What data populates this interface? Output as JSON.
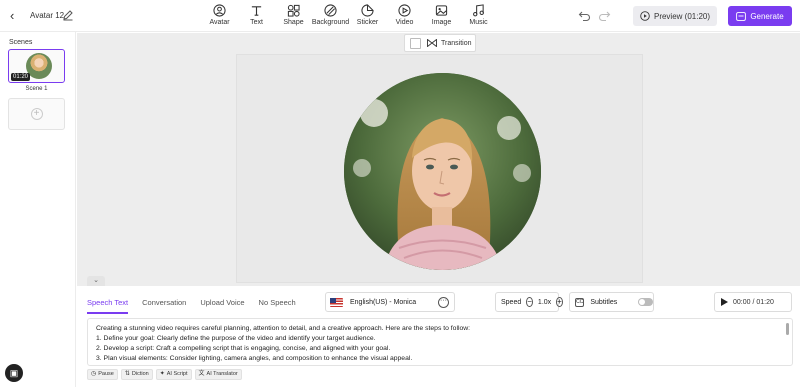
{
  "header": {
    "back_icon": "chevron-left-icon",
    "project_title": "Avatar 12",
    "edit_icon": "pencil-icon",
    "tools": [
      {
        "label": "Avatar",
        "icon": "avatar-icon"
      },
      {
        "label": "Text",
        "icon": "text-icon"
      },
      {
        "label": "Shape",
        "icon": "shape-icon"
      },
      {
        "label": "Background",
        "icon": "background-icon"
      },
      {
        "label": "Sticker",
        "icon": "sticker-icon"
      },
      {
        "label": "Video",
        "icon": "video-icon"
      },
      {
        "label": "Image",
        "icon": "image-icon"
      },
      {
        "label": "Music",
        "icon": "music-icon"
      }
    ],
    "preview_label": "Preview (01:20)",
    "generate_label": "Generate"
  },
  "sidebar": {
    "title": "Scenes",
    "scenes": [
      {
        "label": "Scene 1",
        "duration": "01:20"
      }
    ]
  },
  "canvas": {
    "transition_label": "Transition"
  },
  "panel": {
    "tabs": [
      "Speech Text",
      "Conversation",
      "Upload Voice",
      "No Speech"
    ],
    "active_tab": "Speech Text",
    "voice": "English(US) - Monica",
    "speed_label": "Speed",
    "speed_value": "1.0x",
    "subtitles_label": "Subtitles",
    "subtitles_on": false,
    "player_time": "00:00 / 01:20",
    "script_lines": [
      "Creating a stunning video requires careful planning, attention to detail, and a creative approach. Here are the steps to follow:",
      "1. Define your goal: Clearly define the purpose of the video and identify your target audience.",
      "2. Develop a script: Craft a compelling script that is engaging, concise, and aligned with your goal.",
      "3. Plan visual elements: Consider lighting, camera angles, and composition to enhance the visual appeal."
    ],
    "chips": [
      "Pause",
      "Diction",
      "AI Script",
      "AI Translator"
    ]
  },
  "colors": {
    "accent": "#7a3cf0",
    "stage_bg": "#ededed"
  }
}
